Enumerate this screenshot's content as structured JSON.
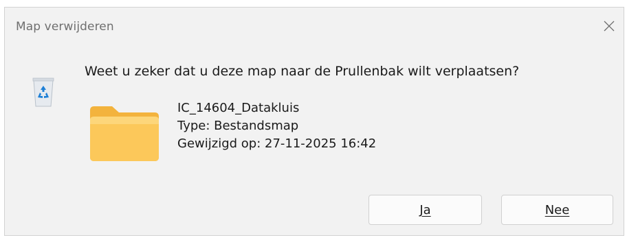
{
  "dialog": {
    "title": "Map verwijderen",
    "close_icon": "close-icon",
    "question": "Weet u zeker dat u deze map naar de Prullenbak wilt verplaatsen?",
    "bin_icon": "recycle-bin-icon",
    "folder_icon": "folder-icon",
    "item": {
      "name": "IC_14604_Datakluis",
      "type": "Type: Bestandsmap",
      "modified": "Gewijzigd op: 27-11-2025 16:42"
    },
    "buttons": {
      "yes_label": "Ja",
      "no_label": "Nee"
    }
  },
  "colors": {
    "dialog_bg": "#f2f2f2",
    "button_bg": "#fbfbfb",
    "folder_yellow": "#fcc85a",
    "bin_blue": "#1d7fd6"
  }
}
